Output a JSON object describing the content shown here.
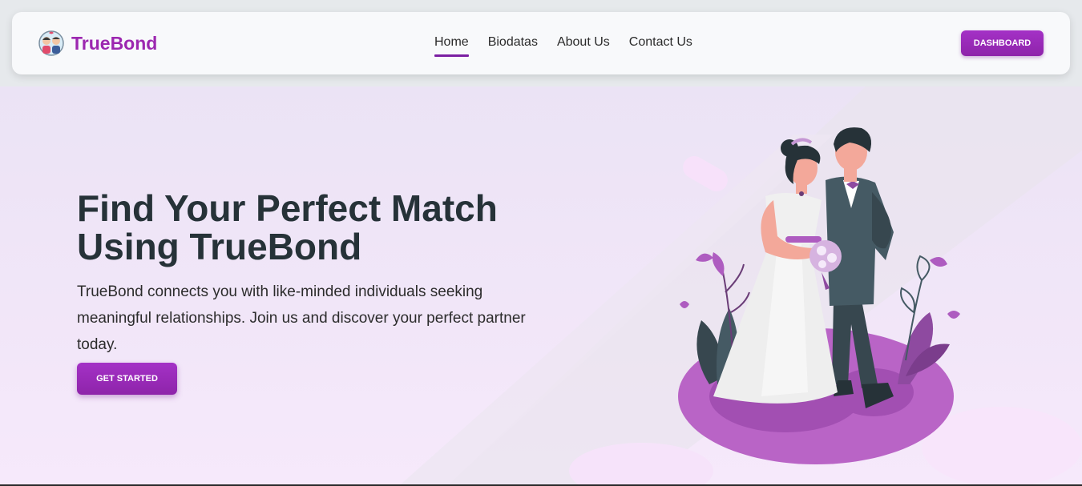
{
  "brand": {
    "name": "TrueBond",
    "logo_icon": "couple-logo-icon"
  },
  "nav": {
    "links": [
      {
        "label": "Home",
        "active": true
      },
      {
        "label": "Biodatas",
        "active": false
      },
      {
        "label": "About Us",
        "active": false
      },
      {
        "label": "Contact Us",
        "active": false
      }
    ],
    "dashboard_label": "DASHBOARD"
  },
  "hero": {
    "title_line1": "Find Your Perfect Match",
    "title_line2": "Using TrueBond",
    "description": "TrueBond connects you with like-minded individuals seeking meaningful relationships. Join us and discover your perfect partner today.",
    "cta_label": "GET STARTED",
    "illustration": "wedding-couple-illustration"
  },
  "colors": {
    "accent": "#9c27b0",
    "nav_underline": "#7b1fa2",
    "title": "#263238",
    "hero_bg": "#f1e6f8"
  }
}
